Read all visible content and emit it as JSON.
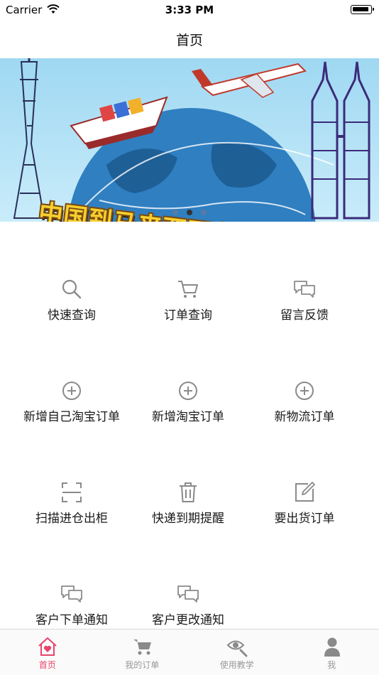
{
  "status_bar": {
    "carrier": "Carrier",
    "time": "3:33 PM"
  },
  "navbar": {
    "title": "首页"
  },
  "banner": {
    "headline": "中国到马来西亚专线",
    "slide_count": 3,
    "active_slide": 2
  },
  "grid": {
    "items": [
      {
        "label": "快速查询",
        "icon": "search-icon"
      },
      {
        "label": "订单查询",
        "icon": "cart-icon"
      },
      {
        "label": "留言反馈",
        "icon": "chat-icon"
      },
      {
        "label": "新增自己淘宝订单",
        "icon": "plus-circle-icon"
      },
      {
        "label": "新增淘宝订单",
        "icon": "plus-circle-icon"
      },
      {
        "label": "新物流订单",
        "icon": "plus-circle-icon"
      },
      {
        "label": "扫描进仓出柜",
        "icon": "scan-icon"
      },
      {
        "label": "快递到期提醒",
        "icon": "trash-icon"
      },
      {
        "label": "要出货订单",
        "icon": "edit-icon"
      },
      {
        "label": "客户下单通知",
        "icon": "chat-icon"
      },
      {
        "label": "客户更改通知",
        "icon": "chat-icon"
      }
    ]
  },
  "tabbar": {
    "tabs": [
      {
        "label": "首页",
        "icon": "home-heart-icon",
        "active": true
      },
      {
        "label": "我的订单",
        "icon": "cart-icon",
        "active": false
      },
      {
        "label": "使用教学",
        "icon": "eye-search-icon",
        "active": false
      },
      {
        "label": "我",
        "icon": "person-icon",
        "active": false
      }
    ]
  },
  "colors": {
    "accent": "#e8436b",
    "icon_gray": "#8a8a8a",
    "tab_gray": "#999999"
  }
}
